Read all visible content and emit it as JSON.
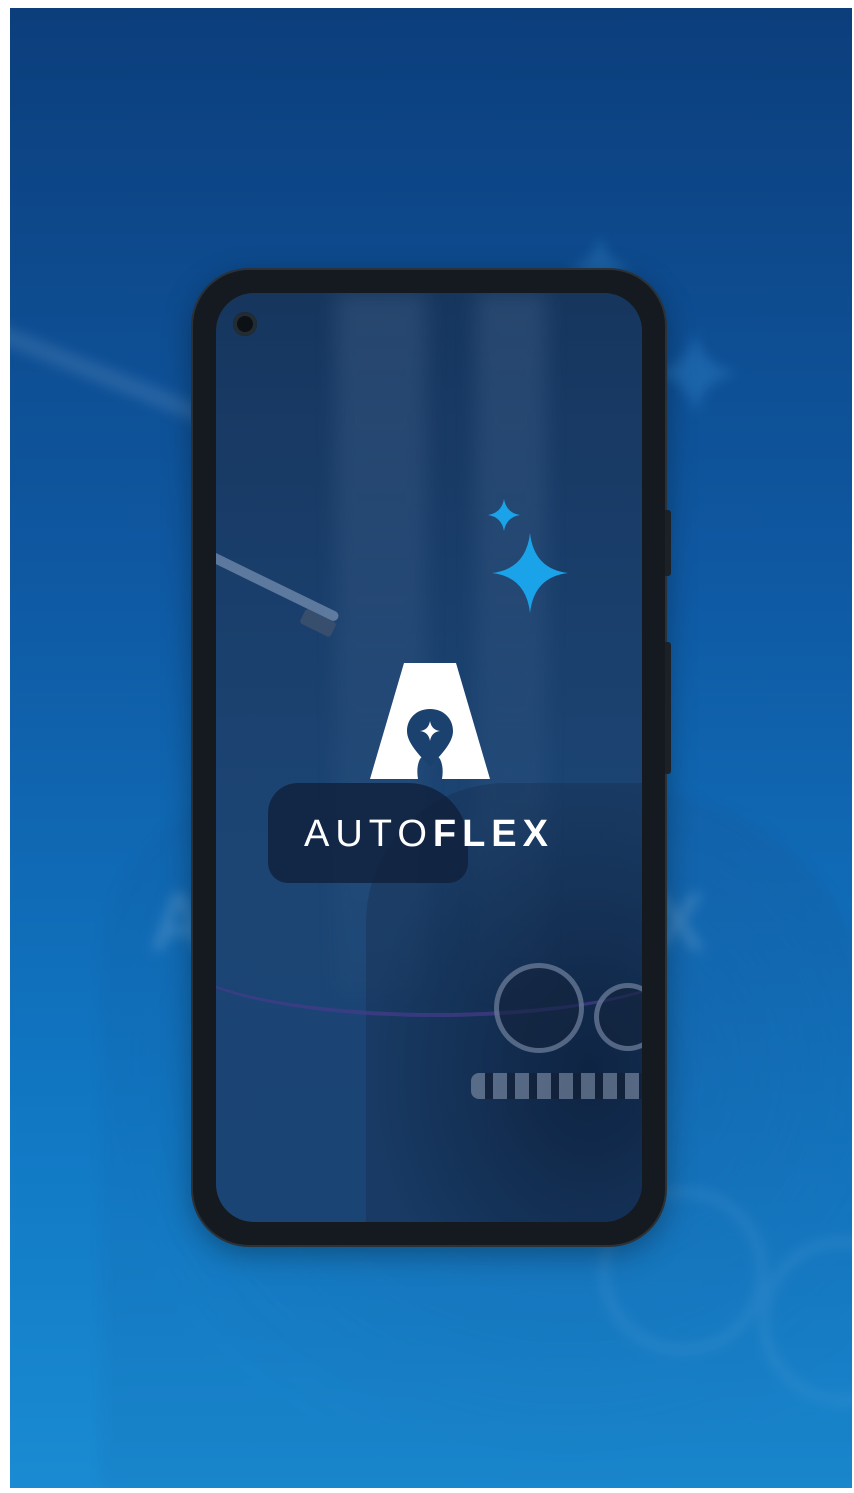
{
  "brand": {
    "name_light": "AUTO",
    "name_bold": "FLEX"
  },
  "background": {
    "text_left": "A",
    "text_right": "X"
  },
  "colors": {
    "accent": "#1aa3e8",
    "phone_frame": "#141a1f",
    "logo": "#ffffff"
  },
  "icons": {
    "logo": "autoflex-logo-icon",
    "sparkle": "sparkle-icon",
    "camera": "front-camera-icon"
  }
}
